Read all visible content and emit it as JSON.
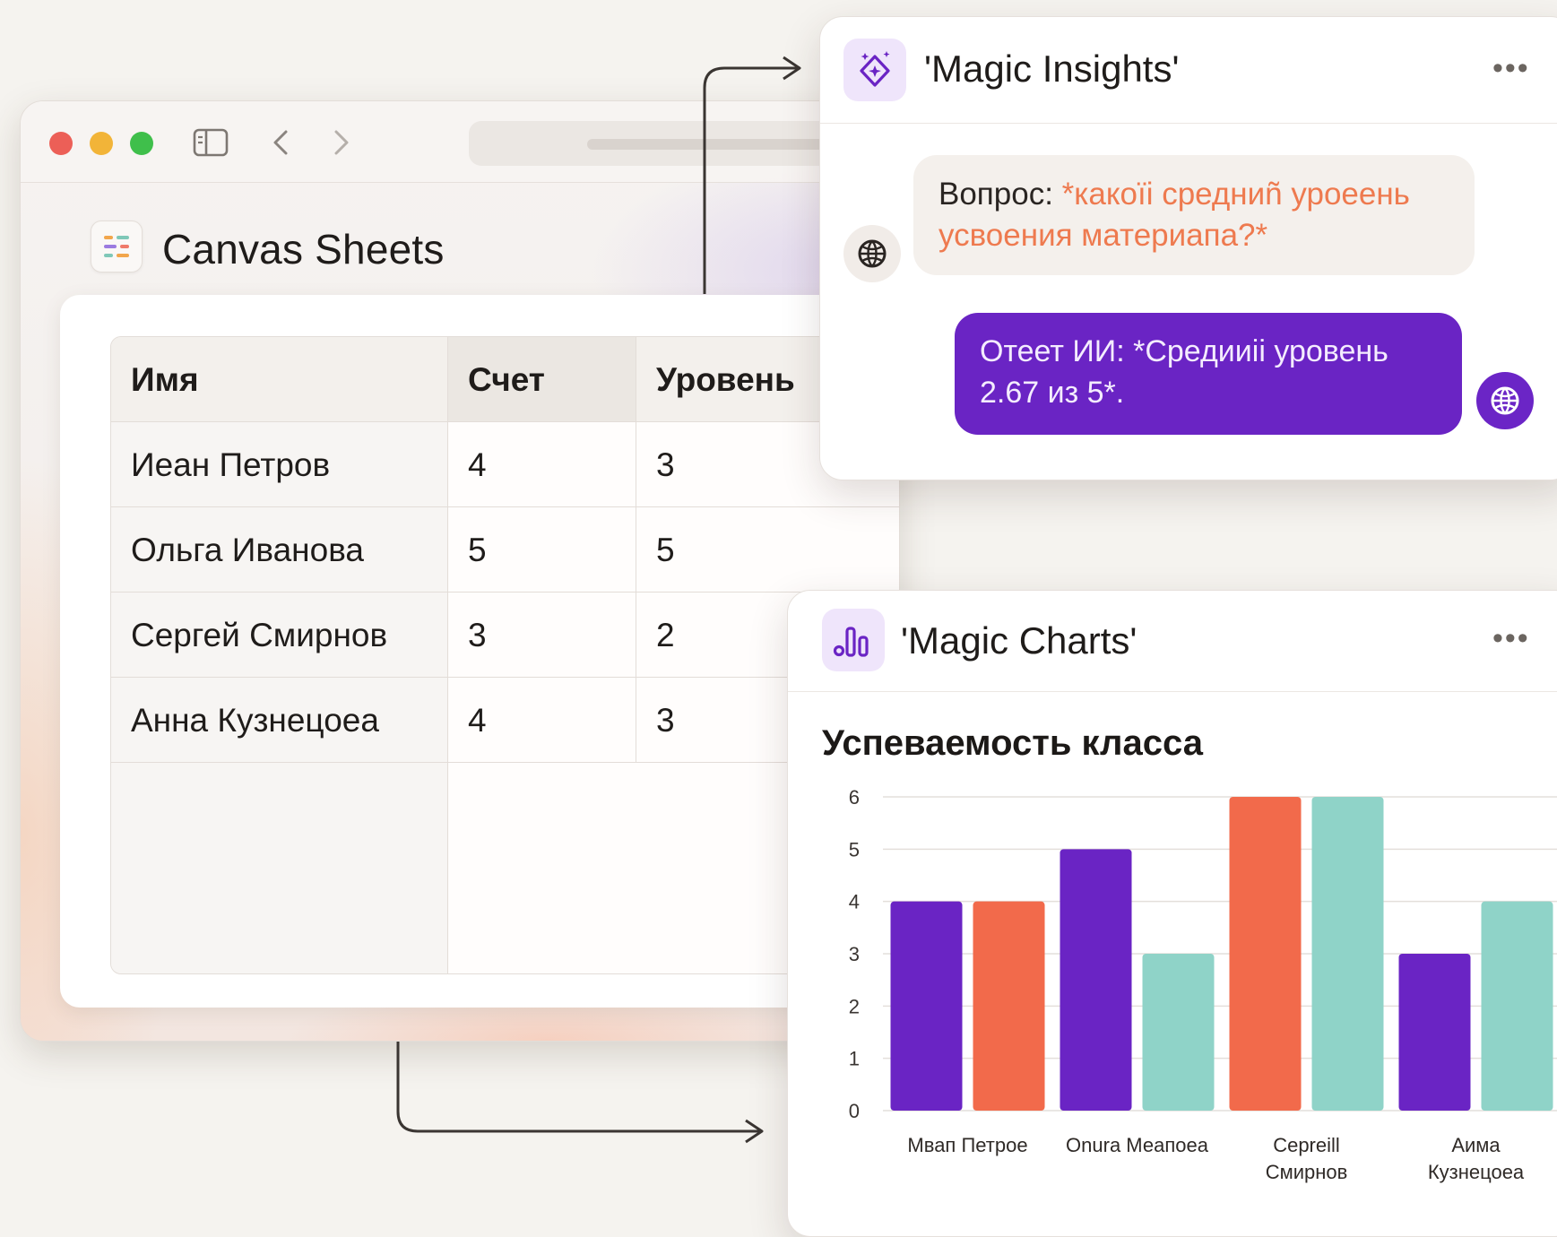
{
  "window": {
    "app_title": "Canvas Sheets"
  },
  "table": {
    "headers": [
      "Имя",
      "Счет",
      "Уровень"
    ],
    "rows": [
      {
        "name": "Иеан Петров",
        "score": "4",
        "level": "3"
      },
      {
        "name": "Ольга Иванова",
        "score": "5",
        "level": "5"
      },
      {
        "name": "Сергей Смирнов",
        "score": "3",
        "level": "2"
      },
      {
        "name": "Анна Кузнецоеа",
        "score": "4",
        "level": "3"
      }
    ]
  },
  "insights": {
    "title": "'Magic Insights'",
    "more": "•••",
    "question_label": "Вопрос: ",
    "question_text_1": "*какоїі средниñ уроеень",
    "question_text_2": "усвоения материапа?*",
    "answer_line_1": "Отеет ИИ: *Средииіі уровень",
    "answer_line_2": "2.67 из 5*."
  },
  "charts": {
    "title": "'Magic Charts'",
    "more": "•••"
  },
  "colors": {
    "purple": "#6a24c4",
    "coral": "#f26a4b",
    "teal": "#8fd3c8",
    "accent_bg": "#efe5fb"
  },
  "chart_data": {
    "type": "bar",
    "title": "Успеваемость класса",
    "categories": [
      "Мвап Петрое",
      "Onura Меапоеа",
      "Cepreill Смирнов",
      "Aима Кузнецоеа"
    ],
    "category_lines": [
      [
        "Мвап Петрое"
      ],
      [
        "Onura Меапоеа"
      ],
      [
        "Cepreill",
        "Смирнов"
      ],
      [
        "Aима",
        "Кузнецоеа"
      ]
    ],
    "series": [
      {
        "color": "#6a24c4",
        "values": [
          4,
          5,
          6,
          3
        ]
      },
      {
        "color": "#f26a4b",
        "values": [
          4,
          3,
          6,
          4
        ]
      }
    ],
    "bars_drawn": [
      {
        "category": 0,
        "value": 4,
        "color": "#6a24c4"
      },
      {
        "category": 0,
        "value": 4,
        "color": "#f26a4b"
      },
      {
        "category": 1,
        "value": 5,
        "color": "#6a24c4"
      },
      {
        "category": 1,
        "value": 3,
        "color": "#8fd3c8"
      },
      {
        "category": 2,
        "value": 6,
        "color": "#f26a4b"
      },
      {
        "category": 2,
        "value": 6,
        "color": "#8fd3c8"
      },
      {
        "category": 3,
        "value": 3,
        "color": "#6a24c4"
      },
      {
        "category": 3,
        "value": 4,
        "color": "#8fd3c8"
      }
    ],
    "ylim": [
      0,
      6
    ],
    "yticks": [
      0,
      1,
      2,
      3,
      4,
      5,
      6
    ],
    "grid": true,
    "legend": "none"
  }
}
